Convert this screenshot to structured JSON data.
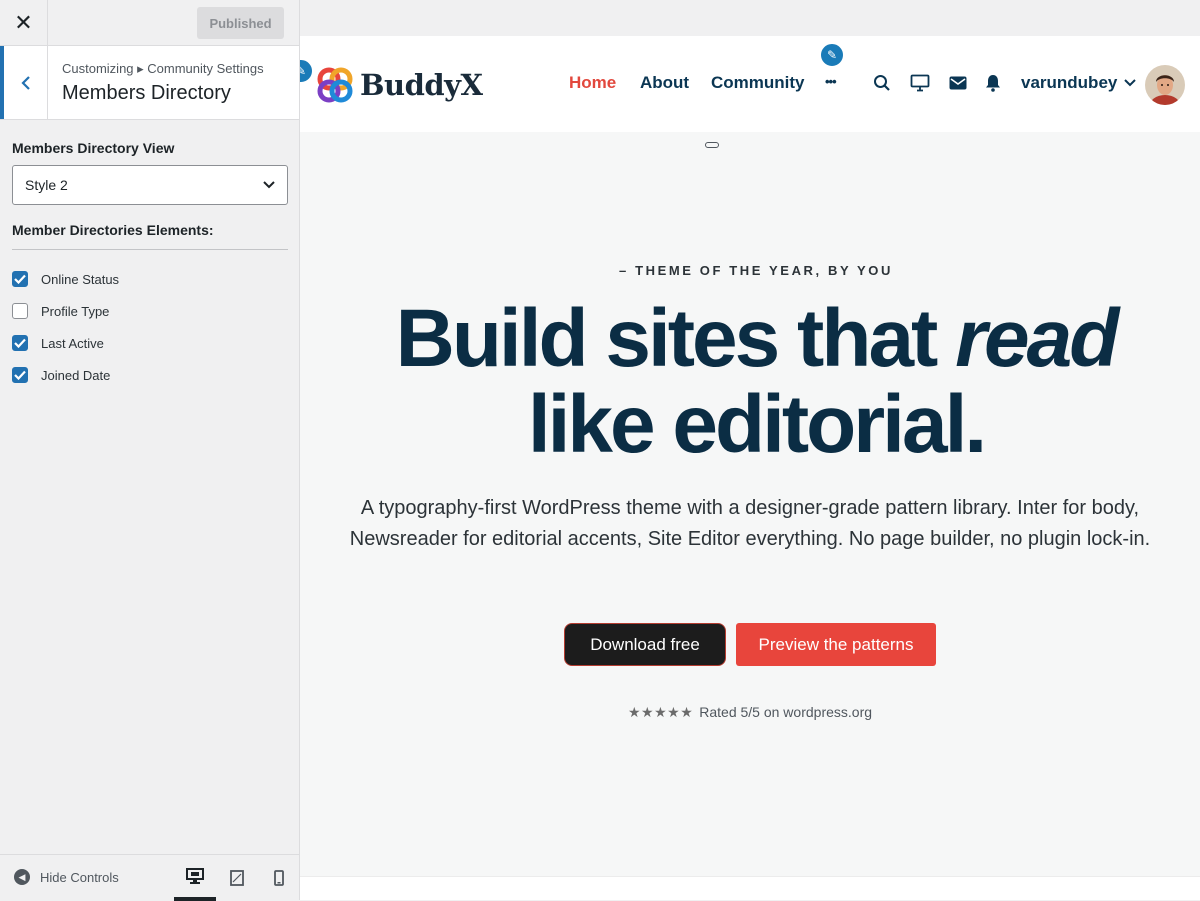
{
  "customizer": {
    "close_icon": "close-icon",
    "publish_label": "Published",
    "breadcrumb": "Customizing ▸ Community Settings",
    "section_title": "Members Directory",
    "view_label": "Members Directory View",
    "view_value": "Style 2",
    "elements_label": "Member Directories Elements:",
    "elements": [
      {
        "label": "Online Status",
        "checked": true
      },
      {
        "label": "Profile Type",
        "checked": false
      },
      {
        "label": "Last Active",
        "checked": true
      },
      {
        "label": "Joined Date",
        "checked": true
      }
    ],
    "hide_controls": "Hide Controls",
    "devices": [
      "desktop",
      "tablet",
      "mobile"
    ],
    "accent": "#2271b1"
  },
  "site": {
    "logo_text": "BuddyX",
    "nav": [
      {
        "label": "Home",
        "current": true
      },
      {
        "label": "About",
        "current": false
      },
      {
        "label": "Community",
        "current": false
      }
    ],
    "more_label": "•••",
    "username": "varundubey",
    "accent": "#e2483d"
  },
  "hero": {
    "eyebrow": "– THEME OF THE YEAR, BY YOU",
    "headline_line1_start": "Build sites that ",
    "headline_line1_em": "read",
    "headline_line2": "like editorial.",
    "body": "A typography-first WordPress theme with a designer-grade pattern library. Inter for body, Newsreader for editorial accents, Site Editor everything. No page builder, no plugin lock-in.",
    "primary_button": "Download free",
    "secondary_button": "Preview the patterns",
    "stars": "★★★★★",
    "rating_text": "Rated 5/5 on wordpress.org",
    "rating_value": 5
  }
}
